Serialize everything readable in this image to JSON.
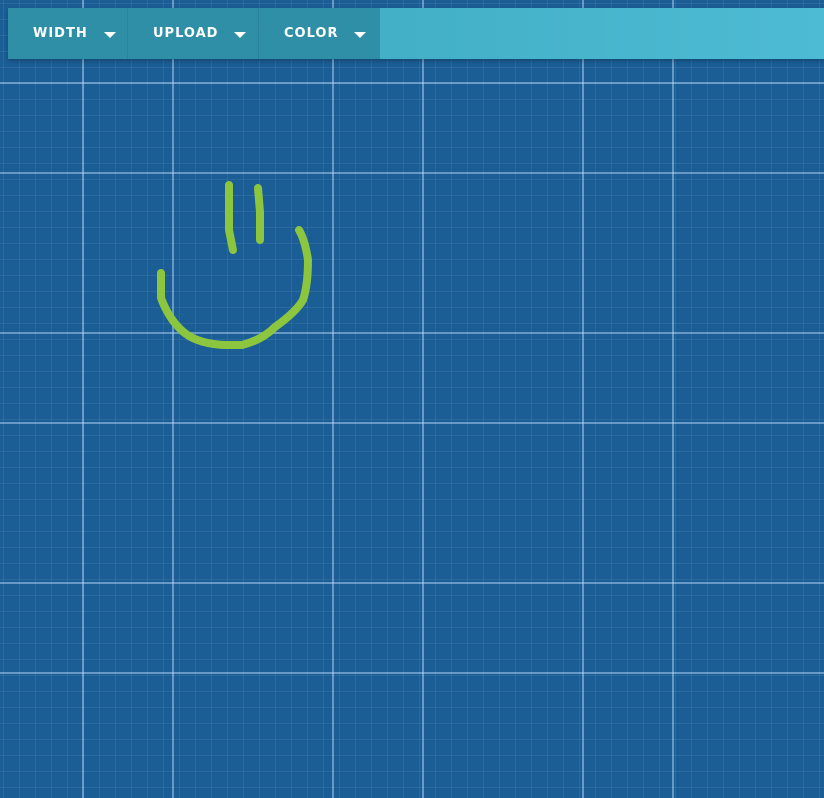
{
  "toolbar": {
    "width_label": "WIDTH",
    "upload_label": "UPLOAD",
    "color_label": "COLOR"
  },
  "icons": {
    "dropdown": "caret-down-icon"
  },
  "colors": {
    "canvas_background": "#1b5e96",
    "toolbar_accent": "#4dbbd3",
    "toolbar_buttons": "#2f8fa7",
    "stroke": "#8cc63f"
  }
}
